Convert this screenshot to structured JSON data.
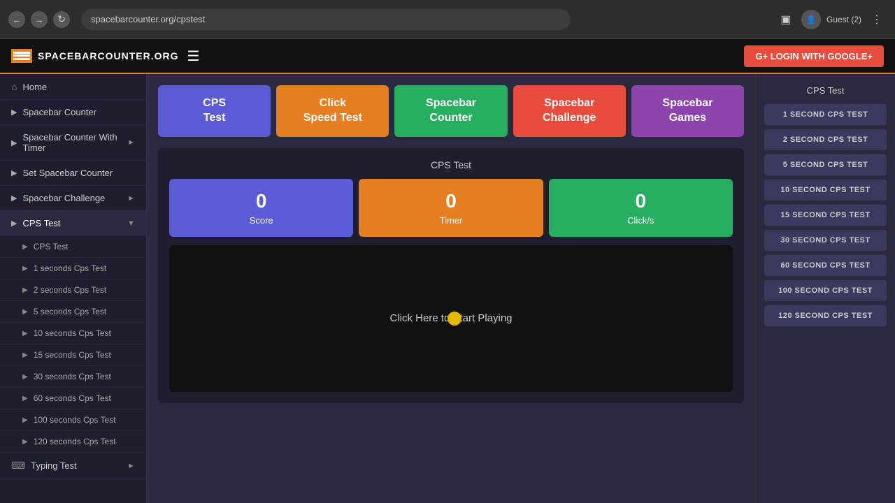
{
  "browser": {
    "url": "spacebarcounter.org/cpstest",
    "guest_label": "Guest (2)"
  },
  "header": {
    "logo_text": "SPACEBARCOUNTER.ORG",
    "login_label": "G+ LOGIN WITH GOOGLE+"
  },
  "sidebar": {
    "items": [
      {
        "id": "home",
        "label": "Home",
        "icon": "🏠",
        "cursor": true
      },
      {
        "id": "spacebar-counter",
        "label": "Spacebar Counter",
        "icon": "⬜",
        "cursor": true
      },
      {
        "id": "spacebar-counter-timer",
        "label": "Spacebar Counter With Timer",
        "icon": "⬜",
        "cursor": true,
        "has_chevron": true
      },
      {
        "id": "set-spacebar-counter",
        "label": "Set Spacebar Counter",
        "icon": "⬜",
        "cursor": true
      },
      {
        "id": "spacebar-challenge",
        "label": "Spacebar Challenge",
        "icon": "⬜",
        "cursor": true,
        "has_chevron": true
      },
      {
        "id": "cps-test",
        "label": "CPS Test",
        "icon": "▶",
        "cursor": true,
        "active": true,
        "has_chevron": true
      }
    ],
    "sub_items": [
      {
        "id": "cps-test-main",
        "label": "CPS Test",
        "cursor": true
      },
      {
        "id": "1s",
        "label": "1 seconds Cps Test",
        "cursor": true
      },
      {
        "id": "2s",
        "label": "2 seconds Cps Test",
        "cursor": true
      },
      {
        "id": "5s",
        "label": "5 seconds Cps Test",
        "cursor": true
      },
      {
        "id": "10s",
        "label": "10 seconds Cps Test",
        "cursor": true
      },
      {
        "id": "15s",
        "label": "15 seconds Cps Test",
        "cursor": true
      },
      {
        "id": "30s",
        "label": "30 seconds Cps Test",
        "cursor": true
      },
      {
        "id": "60s",
        "label": "60 seconds Cps Test",
        "cursor": true
      },
      {
        "id": "100s",
        "label": "100 seconds Cps Test",
        "cursor": true
      },
      {
        "id": "120s",
        "label": "120 seconds Cps Test",
        "cursor": true
      }
    ],
    "typing_item": {
      "label": "Typing Test",
      "icon": "⌨",
      "has_chevron": true
    }
  },
  "nav_cards": [
    {
      "id": "cps-test",
      "label": "CPS\nTest",
      "color": "blue"
    },
    {
      "id": "click-speed-test",
      "label": "Click\nSpeed Test",
      "color": "orange"
    },
    {
      "id": "spacebar-counter",
      "label": "Spacebar\nCounter",
      "color": "green"
    },
    {
      "id": "spacebar-challenge",
      "label": "Spacebar\nChallenge",
      "color": "red"
    },
    {
      "id": "spacebar-games",
      "label": "Spacebar\nGames",
      "color": "purple"
    }
  ],
  "cps_test": {
    "title": "CPS Test",
    "stats": [
      {
        "id": "score",
        "value": "0",
        "label": "Score",
        "color": "blue"
      },
      {
        "id": "timer",
        "value": "0",
        "label": "Timer",
        "color": "orange"
      },
      {
        "id": "clicks",
        "value": "0",
        "label": "Click/s",
        "color": "green"
      }
    ],
    "click_area_text": "Click Here to Start Playing"
  },
  "right_sidebar": {
    "title": "CPS Test",
    "links": [
      "1 SECOND CPS TEST",
      "2 SECOND CPS TEST",
      "5 SECOND CPS TEST",
      "10 SECOND CPS TEST",
      "15 SECOND CPS TEST",
      "30 SECOND CPS TEST",
      "60 SECOND CPS TEST",
      "100 SECOND CPS TEST",
      "120 SECOND CPS TEST"
    ]
  }
}
